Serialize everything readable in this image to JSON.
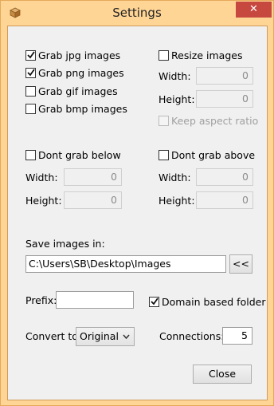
{
  "window": {
    "title": "Settings",
    "close_glyph": "✕"
  },
  "grab": {
    "jpg": {
      "label": "Grab jpg images",
      "checked": true
    },
    "png": {
      "label": "Grab png images",
      "checked": true
    },
    "gif": {
      "label": "Grab gif images",
      "checked": false
    },
    "bmp": {
      "label": "Grab bmp images",
      "checked": false
    }
  },
  "resize": {
    "label": "Resize images",
    "checked": false,
    "width_label": "Width:",
    "width_value": "0",
    "height_label": "Height:",
    "height_value": "0",
    "keep_aspect_label": "Keep aspect ratio",
    "keep_aspect_checked": false
  },
  "dont_grab_below": {
    "label": "Dont grab below",
    "checked": false,
    "width_label": "Width:",
    "width_value": "0",
    "height_label": "Height:",
    "height_value": "0"
  },
  "dont_grab_above": {
    "label": "Dont grab above",
    "checked": false,
    "width_label": "Width:",
    "width_value": "0",
    "height_label": "Height:",
    "height_value": "0"
  },
  "save": {
    "label": "Save images in:",
    "path": "C:\\Users\\SB\\Desktop\\Images",
    "browse_label": "<<"
  },
  "prefix": {
    "label": "Prefix:",
    "value": ""
  },
  "domain_folder": {
    "label": "Domain based folder",
    "checked": true
  },
  "convert": {
    "label": "Convert to:",
    "selected": "Original"
  },
  "connections": {
    "label": "Connections:",
    "value": "5"
  },
  "close_button": {
    "label": "Close"
  },
  "icons": {
    "app": "box-icon",
    "check": "checkmark-icon",
    "dropdown": "chevron-down-icon"
  },
  "colors": {
    "title_bar": "#ffd596",
    "close_button": "#c7483f",
    "client_bg": "#f0f0f0"
  }
}
